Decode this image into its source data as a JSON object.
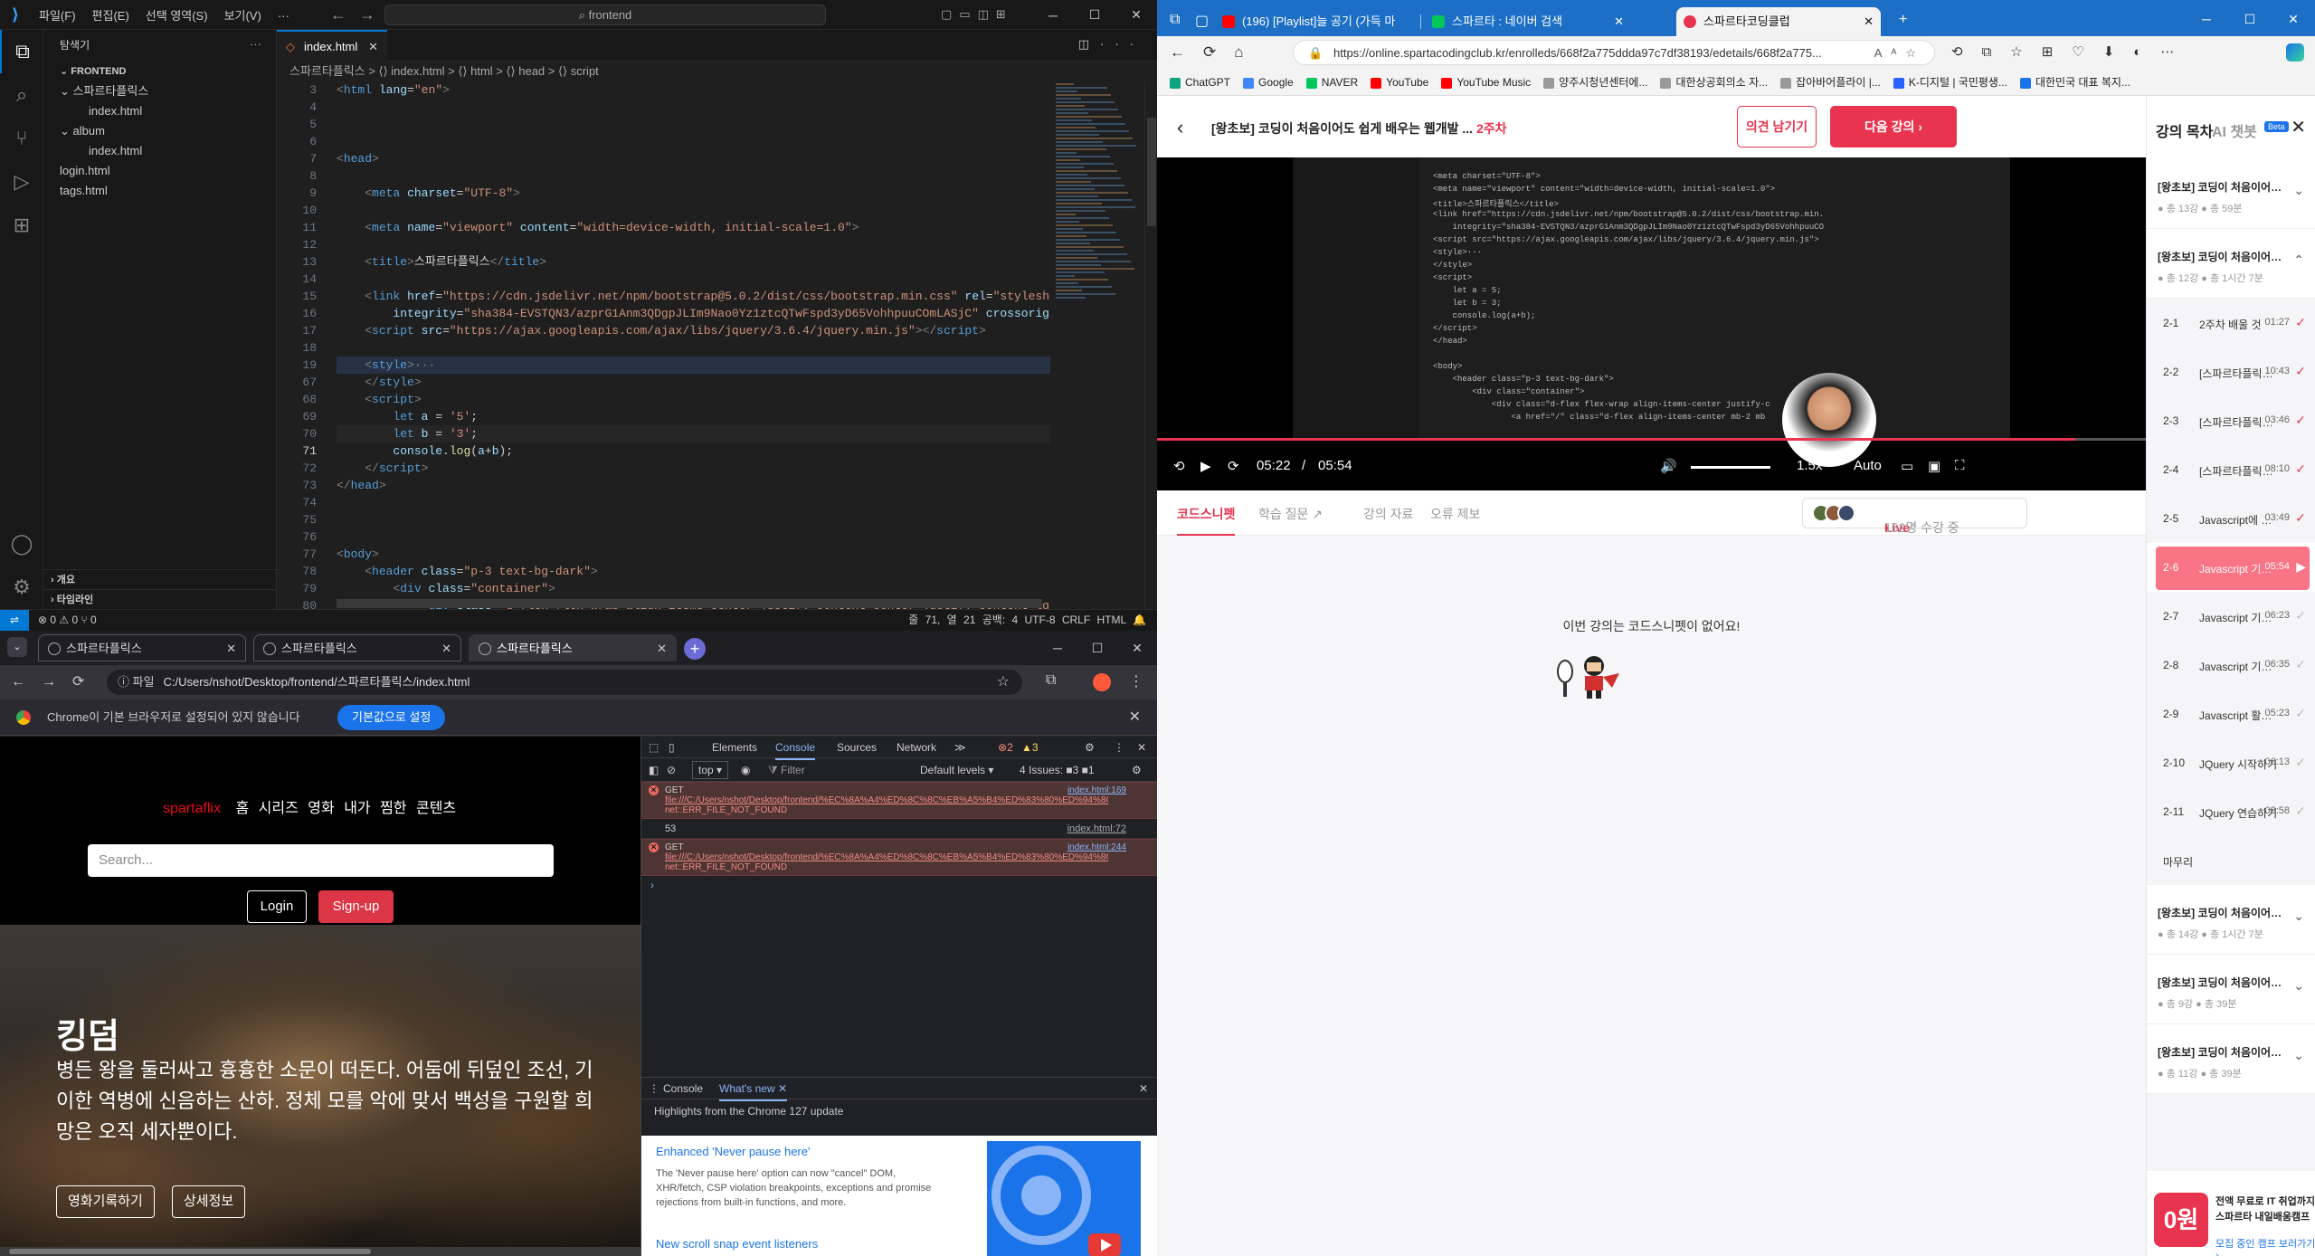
{
  "vscode": {
    "menu": [
      "파일(F)",
      "편집(E)",
      "선택 영역(S)",
      "보기(V)",
      "···"
    ],
    "command_center": "⌕ frontend",
    "sidebar_title": "탐색기",
    "root_folder": "FRONTEND",
    "tree": [
      {
        "label": "스파르타플릭스",
        "depth": 1,
        "type": "folder"
      },
      {
        "label": "index.html",
        "depth": 2,
        "type": "file"
      },
      {
        "label": "album",
        "depth": 1,
        "type": "folder"
      },
      {
        "label": "index.html",
        "depth": 2,
        "type": "file"
      },
      {
        "label": "login.html",
        "depth": 1,
        "type": "file"
      },
      {
        "label": "tags.html",
        "depth": 1,
        "type": "file"
      }
    ],
    "outline_label": "개요",
    "timeline_label": "타임라인",
    "active_tab": "index.html",
    "breadcrumb": "스파르타플릭스 > ⟨⟩ index.html > ⟨⟩ html > ⟨⟩ head > ⟨⟩ script",
    "line_numbers": [
      "3",
      "4",
      "5",
      "6",
      "7",
      "8",
      "9",
      "10",
      "11",
      "12",
      "13",
      "14",
      "15",
      "16",
      "17",
      "18",
      "19",
      "67",
      "68",
      "69",
      "70",
      "71",
      "72",
      "73",
      "74",
      "75",
      "76",
      "77",
      "78",
      "79",
      "80",
      "81"
    ],
    "current_line": "71",
    "status_left": "⊗ 0 ⚠ 0   ⑂ 0",
    "status_right": "줄 71, 열 21   공백: 4   UTF-8   CRLF   HTML   🔔"
  },
  "chrome": {
    "tabs": [
      "스파르타플릭스",
      "스파르타플릭스",
      "스파르타플릭스"
    ],
    "address_chip": "ⓘ 파일",
    "address": "C:/Users/nshot/Desktop/frontend/스파르타플릭스/index.html",
    "infobar_text": "Chrome이 기본 브라우저로 설정되어 있지 않습니다",
    "infobar_button": "기본값으로 설정",
    "site": {
      "brand": "spartaflix",
      "nav": [
        "홈",
        "시리즈",
        "영화",
        "내가 찜한 콘텐츠"
      ],
      "search_placeholder": "Search...",
      "login": "Login",
      "signup": "Sign-up",
      "hero_title": "킹덤",
      "hero_desc": "병든 왕을 둘러싸고 흉흉한 소문이 떠돈다. 어둠에 뒤덮인 조선, 기이한 역병에 신음하는 산하. 정체 모를 악에 맞서 백성을 구원할 희망은 오직 세자뿐이다.",
      "btn_record": "영화기록하기",
      "btn_detail": "상세정보"
    },
    "devtools": {
      "tabs": [
        "Elements",
        "Console",
        "Sources",
        "Network",
        "≫"
      ],
      "active_tab": "Console",
      "errors_count": "2",
      "warnings_count": "3",
      "context": "top ▾",
      "filter_placeholder": "Filter",
      "levels": "Default levels ▾",
      "issues": "4 Issues: ■3 ■1",
      "entries": [
        {
          "type": "error",
          "method": "GET",
          "url": "file:///C:/Users/nshot/Desktop/frontend/%EC%8A%A4%ED%8C%8C%EB%A5%B4%ED%83%80%ED%94%8C%EB%A6%AD%EC%8A%A4",
          "msg": "net::ERR_FILE_NOT_FOUND",
          "src": "index.html:169"
        },
        {
          "type": "log",
          "msg": "53",
          "src": "index.html:72"
        },
        {
          "type": "error",
          "method": "GET",
          "url": "file:///C:/Users/nshot/Desktop/frontend/%EC%8A%A4%ED%8C%8C%EB%A5%B4%ED%83%80%ED%94%8C%EB%A6%AD%EC%8A%A4",
          "msg": "net::ERR_FILE_NOT_FOUND",
          "src": "index.html:244"
        }
      ],
      "drawer_tabs": [
        "Console",
        "What's new"
      ],
      "drawer_active": "What's new",
      "highlights": "Highlights from the Chrome 127 update",
      "feature1_title": "Enhanced 'Never pause here'",
      "feature1_desc": "The 'Never pause here' option can now \"cancel\" DOM, XHR/fetch, CSP violation breakpoints, exceptions and promise rejections from built-in functions, and more.",
      "feature2_title": "New scroll snap event listeners"
    }
  },
  "edge": {
    "tabs": [
      "(196) [Playlist]늘 공기 (가득 마",
      "스파르타 : 네이버 검색",
      "스파르타코딩클럽"
    ],
    "url": "https://online.spartacodingclub.kr/enrolleds/668f2a775ddda97c7df38193/edetails/668f2a775...",
    "bookmarks": [
      "ChatGPT",
      "Google",
      "NAVER",
      "YouTube",
      "YouTube Music",
      "양주시청년센터에...",
      "대한상공회의소 자...",
      "잡아바어플라이 |...",
      "K-디지털 | 국민평생...",
      "대한민국 대표 복지..."
    ],
    "lecture_title": "[왕초보] 코딩이 처음이어도 쉽게 배우는 웹개발 ...",
    "week": "2주차",
    "feedback_btn": "의견 남기기",
    "next_btn": "다음 강의 ›",
    "player": {
      "current": "05:22",
      "total": "05:54",
      "progress": 0.929,
      "speed": "1.5x",
      "quality": "Auto"
    },
    "content_tabs": [
      "코드스니펫",
      "학습 질문 ↗",
      "강의 자료",
      "오류 제보"
    ],
    "active_content_tab": "코드스니펫",
    "live_label": "Live",
    "live_count": "152명 수강 중",
    "empty_message": "이번 강의는 코드스니펫이 없어요!",
    "toc_title": "강의 목차",
    "ai_chatbot": "AI 챗봇",
    "beta": "Beta",
    "sections_top": [
      {
        "title": "[왕초보] 코딩이 처음이어도 쉽게 배...",
        "meta": "● 총 13강  ● 총 59분",
        "open": false
      },
      {
        "title": "[왕초보] 코딩이 처음이어도 쉽게 배...",
        "meta": "● 총 12강  ● 총 1시간 7분",
        "open": true
      }
    ],
    "lectures": [
      {
        "num": "2-1",
        "label": "2주차 배울 것",
        "dur": "01:27",
        "done": true
      },
      {
        "num": "2-2",
        "label": "[스파르타플릭스]프로...",
        "dur": "10:43",
        "done": true
      },
      {
        "num": "2-3",
        "label": "[스파르타플릭스]프로...",
        "dur": "03:46",
        "done": true
      },
      {
        "num": "2-4",
        "label": "[스파르타플릭스]프로...",
        "dur": "08:10",
        "done": true
      },
      {
        "num": "2-5",
        "label": "Javascript에 대해",
        "dur": "03:49",
        "done": true
      },
      {
        "num": "2-6",
        "label": "Javascript 기초문법 1",
        "dur": "05:54",
        "done": false,
        "playing": true
      },
      {
        "num": "2-7",
        "label": "Javascript 기초문법 2",
        "dur": "06:23",
        "done": false
      },
      {
        "num": "2-8",
        "label": "Javascript 기초문법 3",
        "dur": "06:35",
        "done": false
      },
      {
        "num": "2-9",
        "label": "Javascript 활용문법(...",
        "dur": "05:23",
        "done": false
      },
      {
        "num": "2-10",
        "label": "JQuery 시작하기",
        "dur": "06:13",
        "done": false
      },
      {
        "num": "2-11",
        "label": "JQuery 연습하기",
        "dur": "08:58",
        "done": false
      }
    ],
    "wrapup": "마무리",
    "sections_bottom": [
      {
        "title": "[왕초보] 코딩이 처음이어도 쉽게 배...",
        "meta": "● 총 14강  ● 총 1시간 7분"
      },
      {
        "title": "[왕초보] 코딩이 처음이어도 쉽게 배...",
        "meta": "● 총 9강  ● 총 39분"
      },
      {
        "title": "[왕초보] 코딩이 처음이어도 쉽게 배...",
        "meta": "● 총 11강  ● 총 39분"
      }
    ],
    "promo_badge": "0원",
    "promo_text": "전액 무료로 IT 취업까지,\n스파르타 내일배움캠프",
    "promo_link": "모집 중인 캠프 보러가기 ›",
    "accent": "#e8344e"
  }
}
